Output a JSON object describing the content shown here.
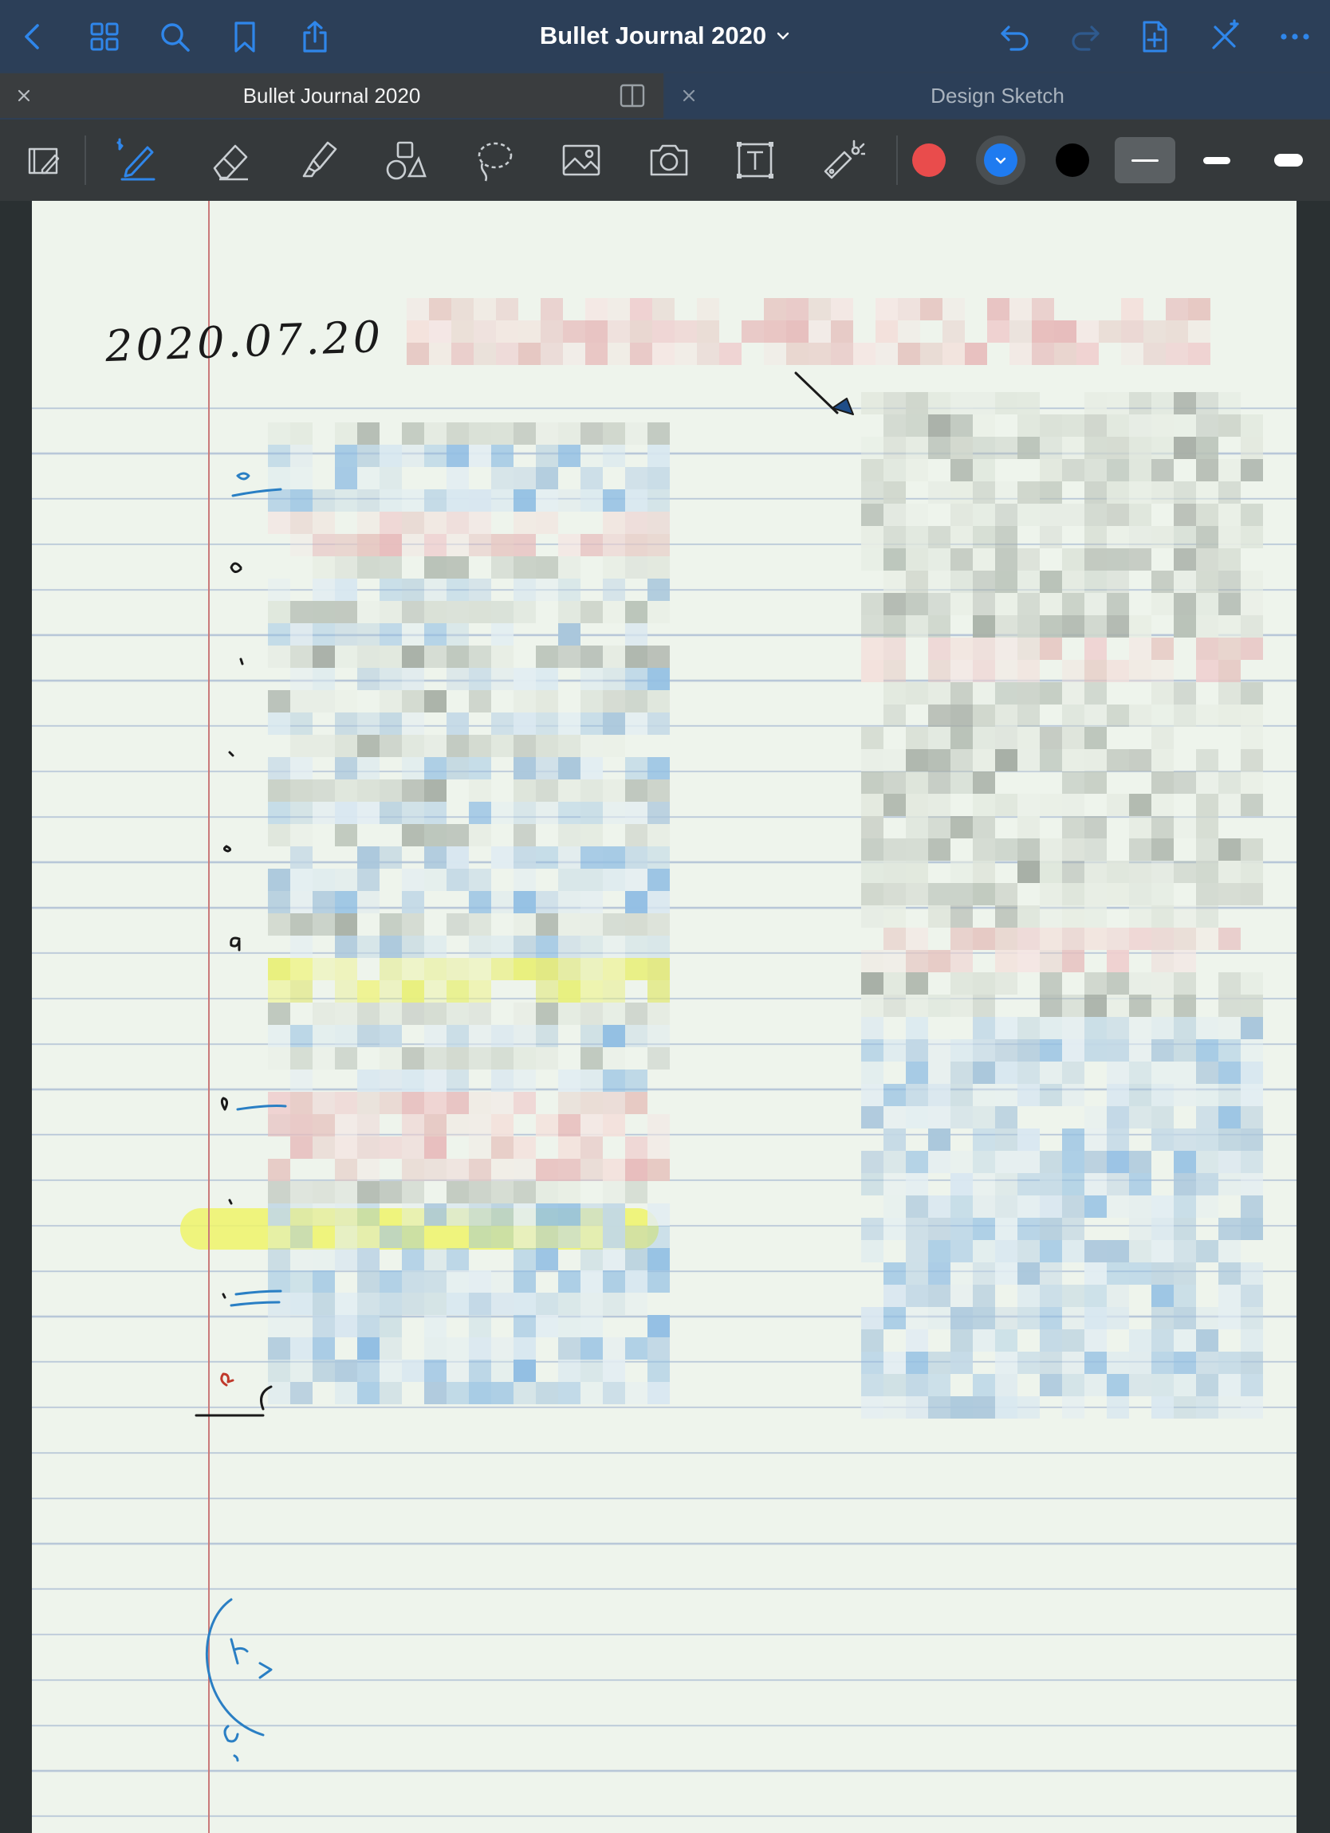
{
  "navbar": {
    "back_icon": "chevron-left-icon",
    "grid_icon": "grid-icon",
    "search_icon": "search-icon",
    "bookmark_icon": "bookmark-icon",
    "share_icon": "share-icon",
    "title": "Bullet Journal 2020",
    "title_caret": "chevron-down-icon",
    "undo_icon": "undo-icon",
    "redo_icon": "redo-icon",
    "add_page_icon": "add-page-icon",
    "close_icon": "close-cross-icon",
    "more_icon": "more-icon"
  },
  "tabs": [
    {
      "label": "Bullet Journal 2020",
      "active": true
    },
    {
      "label": "Design Sketch",
      "active": false
    }
  ],
  "toolbar": {
    "tools": [
      "read-only-icon",
      "pen-icon",
      "eraser-icon",
      "highlighter-icon",
      "shapes-icon",
      "lasso-icon",
      "image-icon",
      "camera-icon",
      "text-icon",
      "laser-pointer-icon"
    ],
    "colors": [
      "#e94c4c",
      "#1f7bf0",
      "#000000"
    ],
    "selected_color": "#1f7bf0",
    "stroke_sizes": [
      "thin",
      "medium",
      "thick"
    ],
    "selected_stroke": "thin"
  },
  "page": {
    "date_text": "2020.07.20",
    "accent_colors": {
      "ink_blue": "#2a7fc4",
      "ink_black": "#1a1a1a",
      "ink_red": "#c0392b",
      "highlight": "#eef36a",
      "margin": "#c97a7a"
    }
  }
}
